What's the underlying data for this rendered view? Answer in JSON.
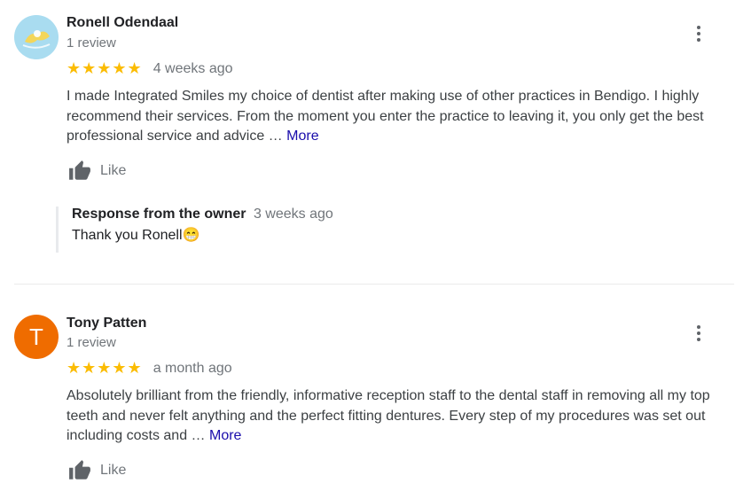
{
  "reviews": [
    {
      "name": "Ronell Odendaal",
      "meta": "1 review",
      "stars": "★★★★★",
      "date": "4 weeks ago",
      "text": "I made Integrated Smiles my choice of dentist after making use of other practices in Bendigo. I highly recommend their services.  From the moment you enter the practice to leaving it, you only get the best professional service and advice …",
      "more_label": "More",
      "like_label": "Like",
      "response": {
        "title": "Response from the owner",
        "date": "3 weeks ago",
        "text": "Thank you Ronell😁"
      }
    },
    {
      "name": "Tony Patten",
      "avatar_letter": "T",
      "meta": "1 review",
      "stars": "★★★★★",
      "date": "a month ago",
      "text": "Absolutely brilliant from the friendly, informative reception staff to the dental staff in removing all my top teeth and never felt anything and the perfect fitting dentures. Every step of my procedures was set out including costs and …",
      "more_label": "More",
      "like_label": "Like"
    }
  ],
  "colors": {
    "star": "#fbbc04",
    "link": "#1a0dab",
    "avatar_orange": "#ef6c00",
    "muted": "#70757a"
  },
  "icons": [
    "avatar-photo",
    "more-vert-icon",
    "thumb-up-icon"
  ]
}
